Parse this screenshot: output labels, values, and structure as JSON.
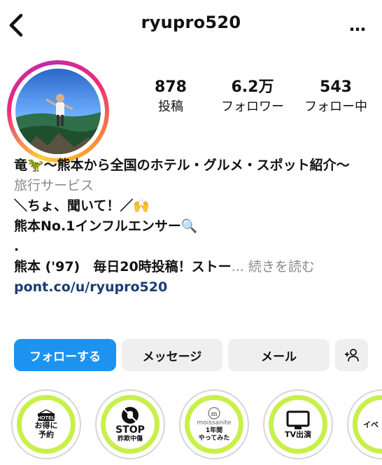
{
  "header": {
    "username": "ryupro520",
    "back_icon": "chevron-left-icon",
    "more_label": "…"
  },
  "stats": {
    "posts": {
      "value": "878",
      "label": "投稿"
    },
    "followers": {
      "value": "6.2万",
      "label": "フォロワー"
    },
    "following": {
      "value": "543",
      "label": "フォロー中"
    }
  },
  "bio": {
    "line1": "竜🦖～熊本から全国のホテル・グルメ・スポット紹介～",
    "category": "旅行サービス",
    "line3": "＼ちょ、聞いて！／🙌",
    "line4": "熊本No.1インフルエンサー🔍",
    "line5": ".",
    "line6": "熊本 ('97)　毎日20時投稿！ストー",
    "more_text": "... 続きを読む",
    "link": "pont.co/u/ryupro520"
  },
  "buttons": {
    "follow": "フォローする",
    "message": "メッセージ",
    "mail": "メール",
    "add_user_icon": "add-user-icon"
  },
  "highlights": {
    "h1_badge": "HOTEL",
    "h1_line1": "お得に",
    "h1_line2": "予約",
    "h2_line1": "STOP",
    "h2_line2": "詐欺中傷",
    "h3_brand": "moissanite",
    "h3_line1": "1年間",
    "h3_line2": "やってみた",
    "h4_line1": "TV出演",
    "h5_line1": "イベ"
  },
  "colors": {
    "follow_button": "#1d93f0",
    "secondary_button": "#efefef",
    "highlight_ring": "#c8f04a",
    "link": "#1a3d72",
    "muted_text": "#8a8a8a"
  }
}
